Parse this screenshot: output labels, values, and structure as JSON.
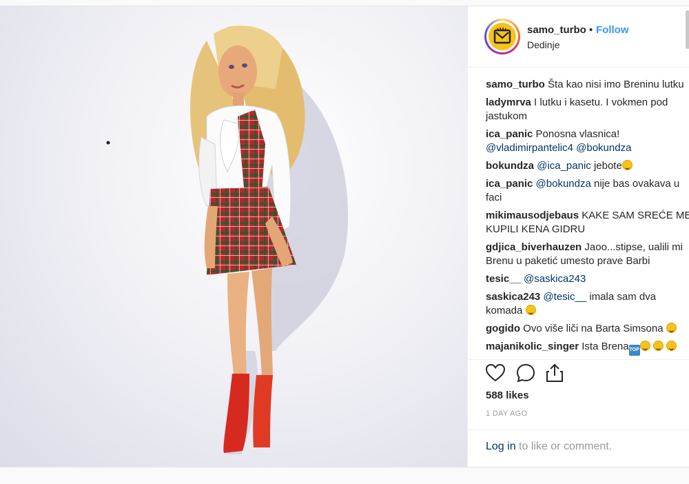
{
  "post": {
    "username": "samo_turbo",
    "separator": "•",
    "follow_label": "Follow",
    "location": "Dedinje",
    "comments": [
      {
        "user": "samo_turbo",
        "text": " Šta kao nisi imo Breninu lutku"
      },
      {
        "user": "ladymrva",
        "text": " I lutku i kasetu. I vokmen pod jastukom"
      },
      {
        "user": "ica_panic",
        "text": " Ponosna vlasnica! ",
        "mention1": "@vladimirpantelic4",
        "mid": " ",
        "mention2": "@bokundza"
      },
      {
        "user": "bokundza",
        "mention1": "@ica_panic",
        "text": " jebote"
      },
      {
        "user": "ica_panic",
        "mention1": "@bokundza",
        "text": " nije bas ovakava u faci"
      },
      {
        "user": "mikimausodjebaus",
        "text": " KAKE SAM SREĆE MENI KUPILI KENA GIDRU"
      },
      {
        "user": "gdjica_biverhauzen",
        "text": " Jaoo...stipse, ualili mi Brenu u paketić umesto prave Barbi"
      },
      {
        "user": "tesic__",
        "mention1": "@saskica243"
      },
      {
        "user": "saskica243",
        "mention1": "@tesic__",
        "text": " imala sam dva komada "
      },
      {
        "user": "gogido",
        "text": " Ovo više liči na Barta Simsona "
      },
      {
        "user": "majanikolic_singer",
        "text": " Ista Brena",
        "top_emoji": "TOP"
      }
    ],
    "likes": "588 likes",
    "time": "1 DAY AGO",
    "login_link": "Log in",
    "login_text": " to like or comment."
  },
  "icons": [
    "heart-icon",
    "comment-icon",
    "share-icon"
  ],
  "colors": {
    "accent": "#3897f0",
    "mention": "#003569",
    "muted": "#999999"
  }
}
